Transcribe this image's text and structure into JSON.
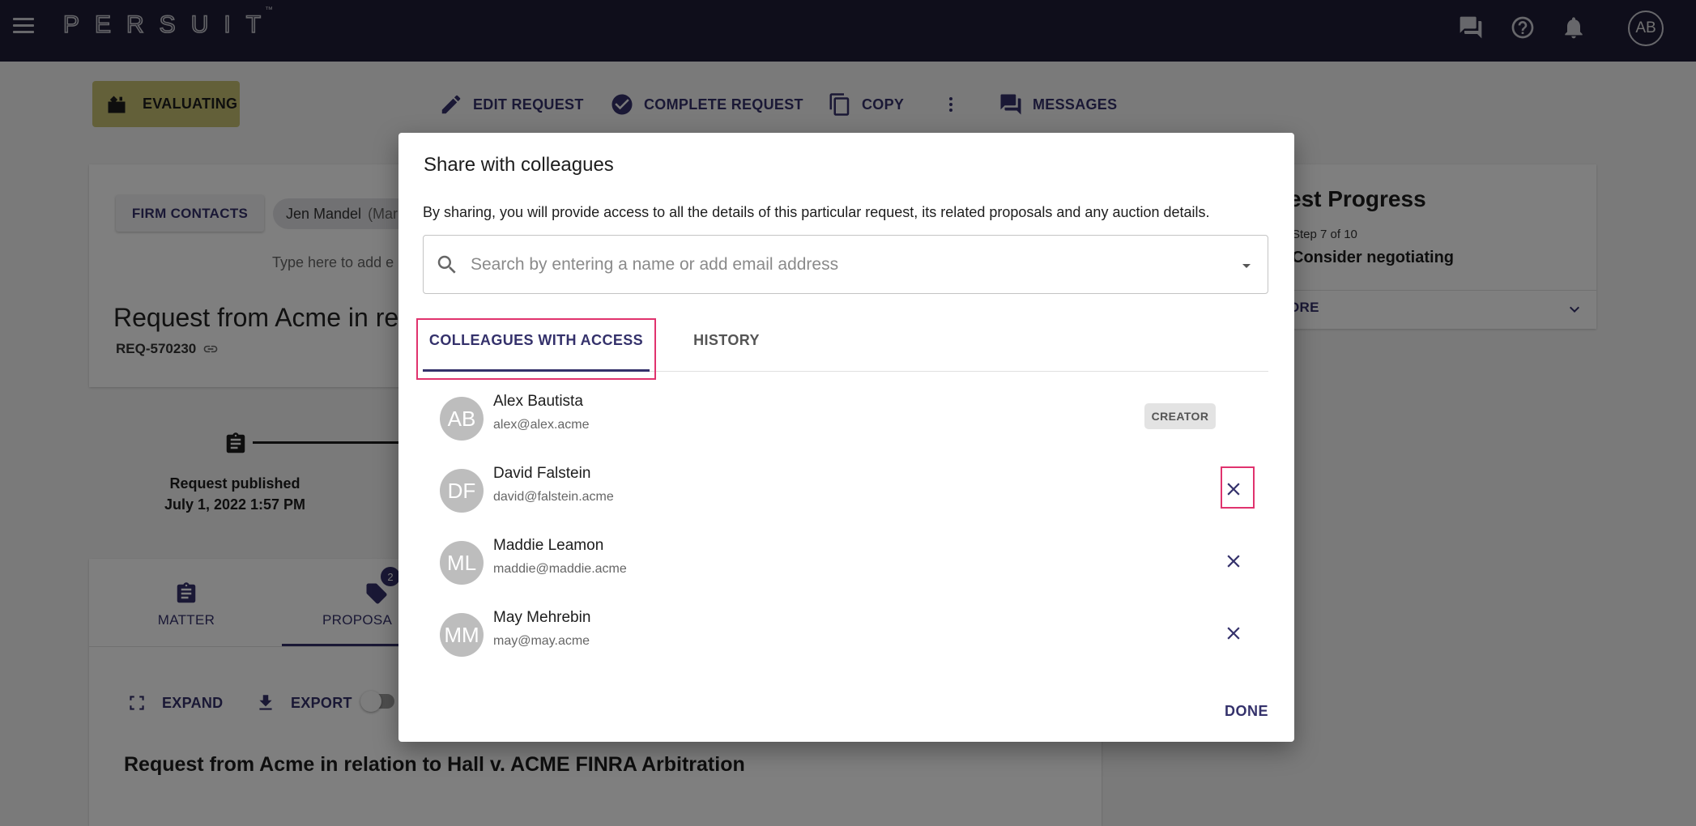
{
  "app": {
    "logo": "PERSUIT",
    "trademark": "™",
    "user_initials": "AB"
  },
  "action_bar": {
    "status": "EVALUATING",
    "edit": "EDIT REQUEST",
    "complete": "COMPLETE REQUEST",
    "copy": "COPY",
    "messages": "MESSAGES"
  },
  "request_card": {
    "firm_contacts": "FIRM CONTACTS",
    "contact_name": "Jen Mandel",
    "contact_extra": "(Mar",
    "type_here": "Type here to add e",
    "title": "Request from Acme in rel",
    "id": "REQ-570230"
  },
  "timeline": {
    "label": "Request published",
    "date": "July 1, 2022 1:57 PM"
  },
  "progress": {
    "title": "est Progress",
    "step": "Step 7 of 10",
    "next": "Consider negotiating",
    "more": "ORE"
  },
  "tabs_card": {
    "matter": "MATTER",
    "proposals": "PROPOSA",
    "proposals_badge": "2",
    "expand": "EXPAND",
    "export": "EXPORT",
    "heading": "Request from Acme in relation to Hall v. ACME FINRA Arbitration"
  },
  "dialog": {
    "title": "Share with colleagues",
    "description": "By sharing, you will provide access to all the details of this particular request, its related proposals and any auction details.",
    "search_placeholder": "Search by entering a name or add email address",
    "tab_colleagues": "COLLEAGUES WITH ACCESS",
    "tab_history": "HISTORY",
    "done": "DONE",
    "colleagues": [
      {
        "initials": "AB",
        "name": "Alex Bautista",
        "email": "alex@alex.acme",
        "role": "CREATOR"
      },
      {
        "initials": "DF",
        "name": "David Falstein",
        "email": "david@falstein.acme"
      },
      {
        "initials": "ML",
        "name": "Maddie Leamon",
        "email": "maddie@maddie.acme"
      },
      {
        "initials": "MM",
        "name": "May Mehrebin",
        "email": "may@may.acme"
      }
    ]
  },
  "colors": {
    "topbar": "#1f1d36",
    "accent": "#34316b",
    "status_chip": "#c6c072",
    "highlight": "#e0336e"
  }
}
